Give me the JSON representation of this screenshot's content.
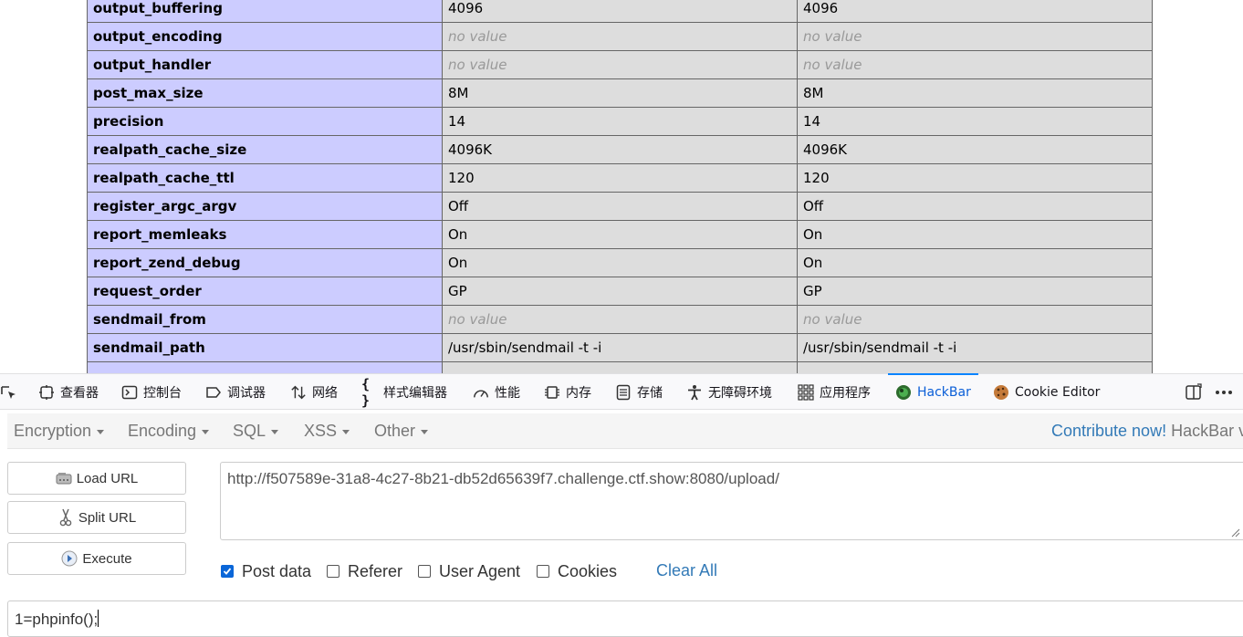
{
  "phpinfo": {
    "rows": [
      {
        "directive": "output_buffering",
        "local": "4096",
        "master": "4096"
      },
      {
        "directive": "output_encoding",
        "local": "no value",
        "master": "no value"
      },
      {
        "directive": "output_handler",
        "local": "no value",
        "master": "no value"
      },
      {
        "directive": "post_max_size",
        "local": "8M",
        "master": "8M"
      },
      {
        "directive": "precision",
        "local": "14",
        "master": "14"
      },
      {
        "directive": "realpath_cache_size",
        "local": "4096K",
        "master": "4096K"
      },
      {
        "directive": "realpath_cache_ttl",
        "local": "120",
        "master": "120"
      },
      {
        "directive": "register_argc_argv",
        "local": "Off",
        "master": "Off"
      },
      {
        "directive": "report_memleaks",
        "local": "On",
        "master": "On"
      },
      {
        "directive": "report_zend_debug",
        "local": "On",
        "master": "On"
      },
      {
        "directive": "request_order",
        "local": "GP",
        "master": "GP"
      },
      {
        "directive": "sendmail_from",
        "local": "no value",
        "master": "no value"
      },
      {
        "directive": "sendmail_path",
        "local": "/usr/sbin/sendmail -t -i",
        "master": "/usr/sbin/sendmail -t -i"
      },
      {
        "directive": "",
        "local": "",
        "master": ""
      }
    ]
  },
  "devtools": {
    "tabs": [
      {
        "label": "查看器",
        "icon": "inspector-icon"
      },
      {
        "label": "控制台",
        "icon": "console-icon"
      },
      {
        "label": "调试器",
        "icon": "debugger-icon"
      },
      {
        "label": "网络",
        "icon": "network-icon"
      },
      {
        "label": "样式编辑器",
        "icon": "style-editor-icon"
      },
      {
        "label": "性能",
        "icon": "performance-icon"
      },
      {
        "label": "内存",
        "icon": "memory-icon"
      },
      {
        "label": "存储",
        "icon": "storage-icon"
      },
      {
        "label": "无障碍环境",
        "icon": "accessibility-icon"
      },
      {
        "label": "应用程序",
        "icon": "application-icon"
      },
      {
        "label": "HackBar",
        "icon": "hackbar-icon"
      },
      {
        "label": "Cookie Editor",
        "icon": "cookie-icon"
      }
    ],
    "active_tab": "HackBar"
  },
  "hackbar": {
    "menus": [
      "Encryption",
      "Encoding",
      "SQL",
      "XSS",
      "Other"
    ],
    "contribute_link": "Contribute now!",
    "contribute_rest": "HackBar v",
    "load_url": "Load URL",
    "split_url": "Split URL",
    "execute": "Execute",
    "url_value": "http://f507589e-31a8-4c27-8b21-db52d65639f7.challenge.ctf.show:8080/upload/",
    "options": [
      {
        "label": "Post data",
        "checked": true
      },
      {
        "label": "Referer",
        "checked": false
      },
      {
        "label": "User Agent",
        "checked": false
      },
      {
        "label": "Cookies",
        "checked": false
      }
    ],
    "clear_all": "Clear All",
    "post_value": "1=phpinfo();"
  },
  "colors": {
    "directive_bg": "#ccccff",
    "value_bg": "#dddddd",
    "link": "#337ab7",
    "active_tab": "#0a84ff"
  }
}
